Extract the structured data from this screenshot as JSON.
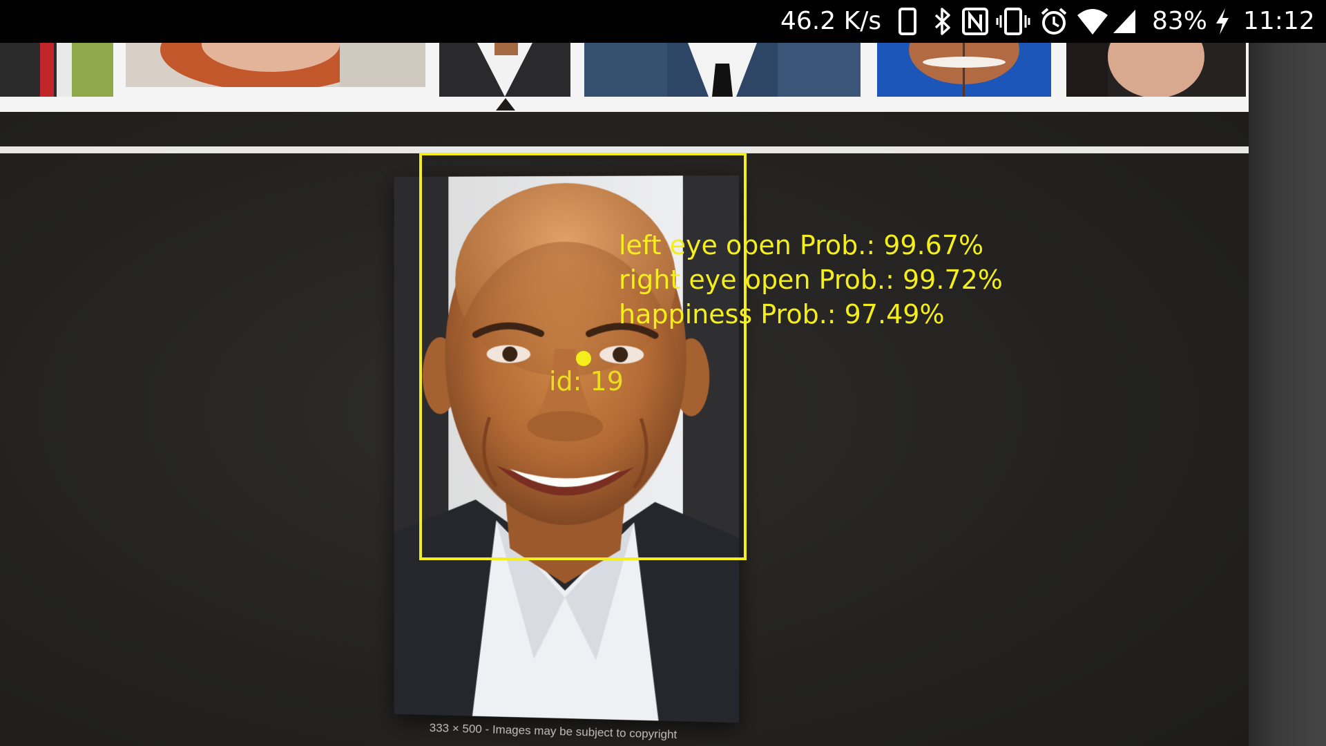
{
  "status_bar": {
    "net_speed": "46.2 K/s",
    "battery_percent": "83%",
    "time": "11:12",
    "icons": [
      "phone-outline-icon",
      "bluetooth-icon",
      "nfc-icon",
      "vibrate-icon",
      "alarm-icon",
      "wifi-icon",
      "cellular-signal-icon",
      "charging-bolt-icon"
    ]
  },
  "image_viewer": {
    "caption": "333 × 500 - Images may be subject to copyright"
  },
  "face_detection": {
    "id_label": "id: 19",
    "left_eye_open": "left eye open Prob.: 99.67%",
    "right_eye_open": "right eye open Prob.: 99.72%",
    "happiness": "happiness Prob.: 97.49%",
    "overlay_color": "#f4ee1a"
  },
  "colors": {
    "status_bar_bg": "#000000",
    "overlay": "#f4ee1a",
    "screen_bg": "#252422"
  }
}
